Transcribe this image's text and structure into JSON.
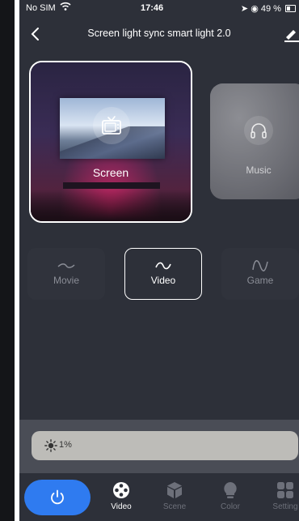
{
  "status_bar": {
    "carrier": "No SIM",
    "time": "17:46",
    "battery": "49 %",
    "battery_level": 0.49
  },
  "header": {
    "title": "Screen light sync smart light 2.0"
  },
  "cards": {
    "screen": {
      "label": "Screen",
      "icon": "tv-icon"
    },
    "music": {
      "label": "Music",
      "icon": "headphones-icon"
    }
  },
  "modes": {
    "movie": {
      "label": "Movie"
    },
    "video": {
      "label": "Video"
    },
    "game": {
      "label": "Game"
    }
  },
  "brightness": {
    "value_text": "1%",
    "icon": "sun-icon"
  },
  "nav": {
    "video": "Video",
    "scene": "Scene",
    "color": "Color",
    "setting": "Setting"
  },
  "colors": {
    "accent": "#2f7bf0",
    "background": "#2d3039"
  }
}
